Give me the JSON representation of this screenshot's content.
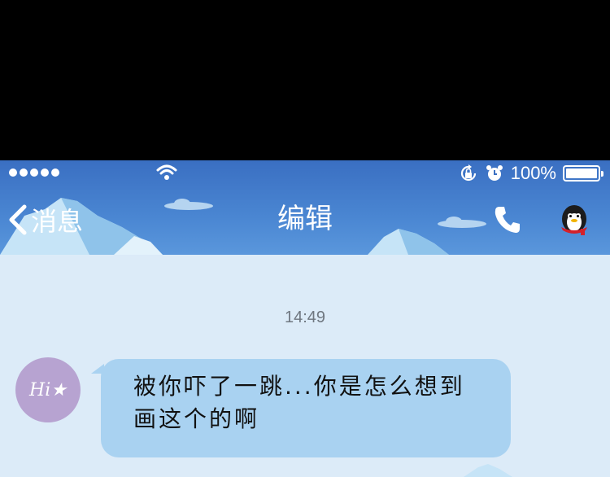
{
  "status_bar": {
    "signal_icon": "signal-dots-icon",
    "wifi_icon": "wifi-icon",
    "rotation_lock_icon": "rotation-lock-icon",
    "alarm_icon": "alarm-icon",
    "battery_text": "100%",
    "battery_level": 1.0
  },
  "header": {
    "back_label": "消息",
    "back_icon": "chevron-left-icon",
    "title": "编辑",
    "call_icon": "phone-icon",
    "profile_icon": "penguin-profile-icon"
  },
  "conversation": {
    "timestamp": "14:49",
    "messages": [
      {
        "avatar_text": "Hi★",
        "lines": [
          "被你吓了一跳...你是怎么想到",
          "画这个的啊"
        ]
      }
    ]
  },
  "colors": {
    "header_blue": "#4a86d2",
    "background": "#dcebf8",
    "bubble": "#a9d2f1",
    "avatar": "#b7a3d1"
  }
}
